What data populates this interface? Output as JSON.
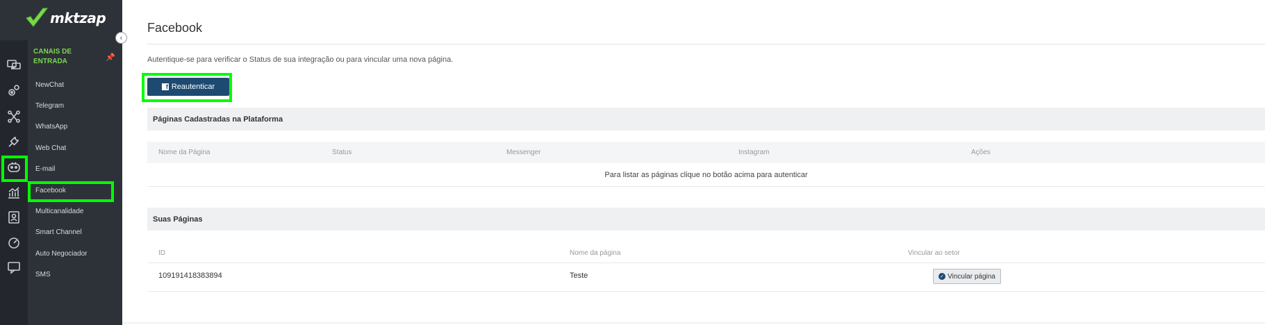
{
  "brand": {
    "name": "mktzap"
  },
  "sidebar": {
    "section_title": "CANAIS DE ENTRADA",
    "items": [
      {
        "label": "NewChat"
      },
      {
        "label": "Telegram"
      },
      {
        "label": "WhatsApp"
      },
      {
        "label": "Web Chat"
      },
      {
        "label": "E-mail"
      },
      {
        "label": "Facebook",
        "active": true
      },
      {
        "label": "Multicanalidade"
      },
      {
        "label": "Smart Channel"
      },
      {
        "label": "Auto Negociador"
      },
      {
        "label": "SMS"
      }
    ],
    "rail_icons": [
      "chat-bubbles-icon",
      "gears-icon",
      "network-icon",
      "plug-icon",
      "bot-icon",
      "analytics-icon",
      "contacts-icon",
      "dashboard-icon",
      "message-icon"
    ]
  },
  "main": {
    "title": "Facebook",
    "intro": "Autentique-se para verificar o Status de sua integração ou para vincular uma nova página.",
    "reauth_label": "Reautenticar",
    "registered": {
      "heading": "Páginas Cadastradas na Plataforma",
      "columns": [
        "Nome da Página",
        "Status",
        "Messenger",
        "Instagram",
        "Ações"
      ],
      "empty_message": "Para listar as páginas clique no botão acima para autenticar"
    },
    "your_pages": {
      "heading": "Suas Páginas",
      "columns": [
        "ID",
        "Nome da página",
        "Vincular ao setor"
      ],
      "rows": [
        {
          "id": "109191418383894",
          "name": "Teste",
          "action": "Vincular página"
        }
      ]
    }
  },
  "colors": {
    "accent_green": "#00ff00",
    "primary_button": "#1d4a70",
    "sidebar_dark": "#23272d",
    "sidebar_panel": "#2d3238",
    "section_title": "#7bd84a"
  }
}
